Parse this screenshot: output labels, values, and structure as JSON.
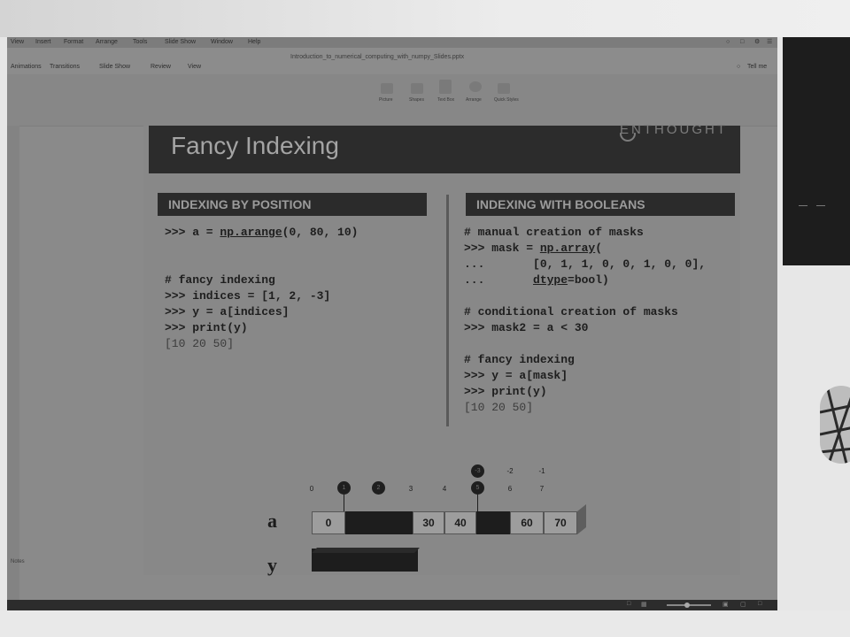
{
  "app": {
    "menubar": [
      "View",
      "Insert",
      "Format",
      "Arrange",
      "Tools",
      "Slide Show",
      "Window",
      "Help"
    ],
    "ribbon_tabs": [
      "Animations",
      "Transitions",
      "Slide Show",
      "Review",
      "View"
    ],
    "document_title": "Introduction_to_numerical_computing_with_numpy_Slides.pptx",
    "tell_me": "Tell me",
    "ribbon_buttons": [
      "Picture",
      "Shapes",
      "Text Box",
      "Arrange",
      "Quick Styles"
    ],
    "notes_label": "Notes"
  },
  "slide": {
    "title": "Fancy Indexing",
    "logo": "ENTHOUGHT",
    "left": {
      "header": "INDEXING BY POSITION",
      "output": "[10 20 50]"
    },
    "right": {
      "header": "INDEXING WITH BOOLEANS",
      "comment1": "# manual creation of masks",
      "line2_rest": " = ",
      "line3": "...       [0, 1, 1, 0, 0, 1, 0, 0],",
      "line4_prefix": "...       ",
      "line4_rest": "=bool)",
      "comment2": "# conditional creation of masks",
      "line5": ">>> mask2 = a < 30",
      "comment3": "# fancy indexing",
      "line6": ">>> y = a[mask]",
      "line7": ">>> print(y)",
      "output": "[10 20 50]"
    },
    "diagram": {
      "array_label": "a",
      "result_label": "y",
      "indices": [
        "0",
        "1",
        "2",
        "3",
        "4",
        "5",
        "6",
        "7"
      ],
      "negative_indices": [
        "-3",
        "-2",
        "-1"
      ],
      "highlighted": [
        "1",
        "2",
        "-3"
      ],
      "values": [
        "0",
        "",
        "",
        "30",
        "40",
        "",
        "60",
        "70"
      ],
      "dark_cells": [
        1,
        2,
        5
      ]
    }
  },
  "colors": {
    "title_bar": "#2c2c2c",
    "slide_bg": "#888888",
    "highlight_cell": "#1d1d1d"
  }
}
